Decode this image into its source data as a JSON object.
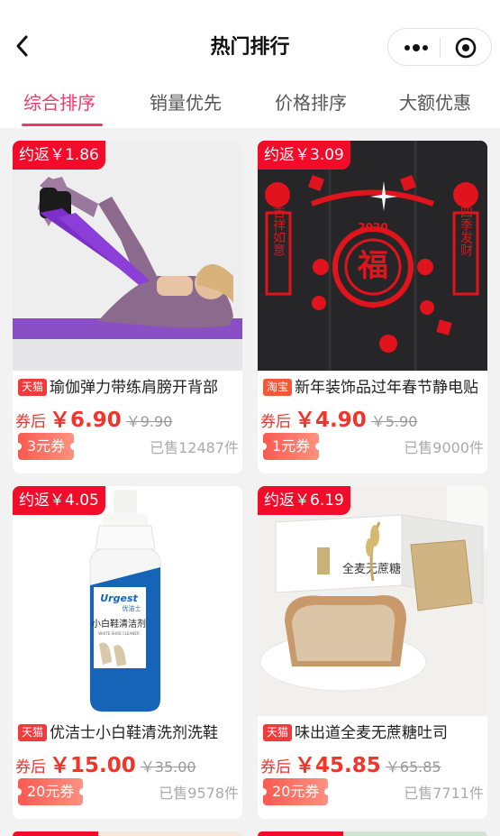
{
  "nav": {
    "title": "热门排行"
  },
  "tabs": [
    {
      "label": "综合排序"
    },
    {
      "label": "销量优先"
    },
    {
      "label": "价格排序"
    },
    {
      "label": "大额优惠"
    }
  ],
  "colors": {
    "accent": "#ee3a6b",
    "price": "#f2342a",
    "rebate": "#f20c2a"
  },
  "products": [
    {
      "rebate": "约返￥1.86",
      "platform": "天猫",
      "title": "瑜伽弹力带练肩膀开背部",
      "after_label": "券后",
      "price": "￥6.90",
      "original": "￥9.90",
      "coupon": "3元券",
      "sold": "已售12487件",
      "image_icon": "yoga-band-photo"
    },
    {
      "rebate": "约返￥3.09",
      "platform": "淘宝",
      "title": "新年装饰品过年春节静电贴",
      "after_label": "券后",
      "price": "￥4.90",
      "original": "￥5.90",
      "coupon": "1元券",
      "sold": "已售9000件",
      "image_icon": "new-year-sticker-photo",
      "image_text": {
        "fu": "福",
        "year": "2020",
        "left": "吉祥如意",
        "right": "四季发财"
      }
    },
    {
      "rebate": "约返￥4.05",
      "platform": "天猫",
      "title": "优洁士小白鞋清洗剂洗鞋",
      "after_label": "券后",
      "price": "￥15.00",
      "original": "￥35.00",
      "coupon": "20元券",
      "sold": "已售9578件",
      "image_icon": "shoe-cleaner-photo",
      "image_text": {
        "brand": "Urgest",
        "brand_cn": "优洁士",
        "label": "小白鞋清洁剂",
        "sub": "WHITE SHOE CLEANER"
      }
    },
    {
      "rebate": "约返￥6.19",
      "platform": "天猫",
      "title": "味出道全麦无蔗糖吐司",
      "after_label": "券后",
      "price": "￥45.85",
      "original": "￥65.85",
      "coupon": "20元券",
      "sold": "已售7711件",
      "image_icon": "whole-wheat-toast-photo",
      "image_text": {
        "box": "全麦无蔗糖"
      }
    }
  ]
}
